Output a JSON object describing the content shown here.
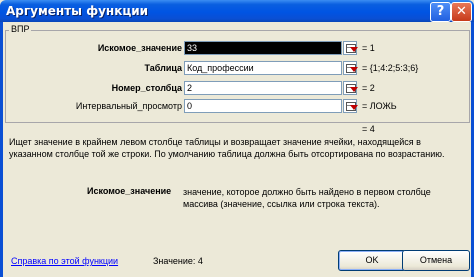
{
  "window": {
    "title": "Аргументы функции",
    "help_glyph": "?",
    "close_glyph": "✕"
  },
  "function_group": {
    "name": "ВПР"
  },
  "arguments": [
    {
      "label": "Искомое_значение",
      "bold": true,
      "value": "33",
      "result": "= 1",
      "selected": true
    },
    {
      "label": "Таблица",
      "bold": true,
      "value": "Код_профессии",
      "result": "= {1;4:2;5:3;6}",
      "selected": false
    },
    {
      "label": "Номер_столбца",
      "bold": true,
      "value": "2",
      "result": "= 2",
      "selected": false
    },
    {
      "label": "Интервальный_просмотр",
      "bold": false,
      "value": "0",
      "result": "= ЛОЖЬ",
      "selected": false
    }
  ],
  "formula_result": "= 4",
  "description": "Ищет значение в крайнем левом столбце таблицы и возвращает значение ячейки, находящейся в указанном столбце той же строки. По умолчанию таблица должна быть отсортирована по возрастанию.",
  "arg_help": {
    "name": "Искомое_значение",
    "text": "значение, которое должно быть найдено в первом столбце массива (значение, ссылка или строка текста)."
  },
  "footer": {
    "help_link": "Справка по этой функции",
    "value_label": "Значение:  4",
    "ok_label": "OK",
    "cancel_label": "Отмена"
  },
  "colors": {
    "titlebar": "#0054e3",
    "dialog_bg": "#ece9d8",
    "link": "#0000ff",
    "selection": "#000000"
  }
}
